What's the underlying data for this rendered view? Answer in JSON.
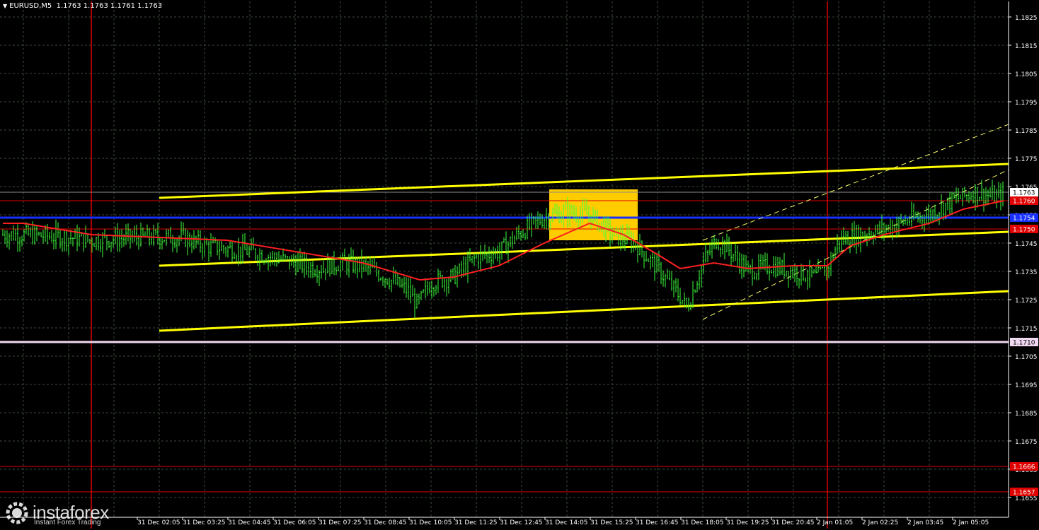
{
  "header": {
    "symbol": "EURUSD,M5",
    "ohlc": "1.1763 1.1763 1.1761 1.1763"
  },
  "watermark": {
    "name": "instaforex",
    "tagline": "Instant Forex Trading"
  },
  "colors": {
    "background": "#000000",
    "grid": "#3a4a3a",
    "candles": "#3cff3c",
    "moving_average": "#ff2020",
    "channel": "#ffff00",
    "trend_dashed": "#ffff66",
    "level_red": "#e00000",
    "level_blue": "#1830ff",
    "level_pink": "#f0d8f0",
    "highlight_box": "#ffcc00",
    "axis_text": "#ffffff"
  },
  "chart_data": {
    "type": "candlestick",
    "title": "EURUSD,M5",
    "ylim": [
      1.165,
      1.183
    ],
    "y_ticks": [
      "1.1825",
      "1.1815",
      "1.1805",
      "1.1795",
      "1.1785",
      "1.1775",
      "1.1765",
      "1.1755",
      "1.1745",
      "1.1735",
      "1.1725",
      "1.1715",
      "1.1705",
      "1.1695",
      "1.1685",
      "1.1675",
      "1.1665",
      "1.1655"
    ],
    "x_ticks": [
      "31 Dec 02:05",
      "31 Dec 03:25",
      "31 Dec 04:45",
      "31 Dec 06:05",
      "31 Dec 07:25",
      "31 Dec 08:45",
      "31 Dec 10:05",
      "31 Dec 11:25",
      "31 Dec 12:45",
      "31 Dec 14:05",
      "31 Dec 15:25",
      "31 Dec 16:45",
      "31 Dec 18:05",
      "31 Dec 19:25",
      "31 Dec 20:45",
      "2 Jan 01:05",
      "2 Jan 02:25",
      "2 Jan 03:45",
      "2 Jan 05:05"
    ],
    "grid": true,
    "price_path": [
      [
        0,
        1.1748
      ],
      [
        2,
        1.1747
      ],
      [
        3,
        1.1746
      ],
      [
        5,
        1.1747
      ],
      [
        7,
        1.1747
      ],
      [
        8,
        1.1744
      ],
      [
        9,
        1.1743
      ],
      [
        10,
        1.1742
      ],
      [
        11,
        1.174
      ],
      [
        12,
        1.1738
      ],
      [
        13,
        1.1736
      ],
      [
        14,
        1.1738
      ],
      [
        15,
        1.1737
      ],
      [
        16,
        1.1733
      ],
      [
        17,
        1.1728
      ],
      [
        17.4,
        1.1723
      ],
      [
        18,
        1.1731
      ],
      [
        19,
        1.1733
      ],
      [
        20,
        1.174
      ],
      [
        21,
        1.1742
      ],
      [
        22,
        1.1749
      ],
      [
        23,
        1.1754
      ],
      [
        24,
        1.1756
      ],
      [
        25,
        1.1755
      ],
      [
        26,
        1.1748
      ],
      [
        27,
        1.1745
      ],
      [
        28,
        1.1736
      ],
      [
        29,
        1.1726
      ],
      [
        29.3,
        1.1722
      ],
      [
        30,
        1.1738
      ],
      [
        30.6,
        1.1746
      ],
      [
        31,
        1.1744
      ],
      [
        32,
        1.1735
      ],
      [
        33,
        1.1737
      ],
      [
        34,
        1.1735
      ],
      [
        35,
        1.1733
      ],
      [
        35.5,
        1.1736
      ],
      [
        36,
        1.1746
      ],
      [
        37,
        1.1748
      ],
      [
        38,
        1.175
      ],
      [
        39,
        1.1753
      ],
      [
        40,
        1.1755
      ],
      [
        41,
        1.176
      ],
      [
        42,
        1.1763
      ],
      [
        43,
        1.1761
      ],
      [
        43.3,
        1.1763
      ]
    ],
    "moving_average": [
      [
        0,
        1.1752
      ],
      [
        3,
        1.1748
      ],
      [
        6,
        1.1747
      ],
      [
        9,
        1.1746
      ],
      [
        12,
        1.1742
      ],
      [
        15,
        1.1738
      ],
      [
        17.5,
        1.1732
      ],
      [
        19,
        1.1733
      ],
      [
        21,
        1.1737
      ],
      [
        23,
        1.1745
      ],
      [
        25,
        1.1752
      ],
      [
        26.5,
        1.1748
      ],
      [
        28,
        1.1741
      ],
      [
        29,
        1.1736
      ],
      [
        30.5,
        1.1738
      ],
      [
        32,
        1.1736
      ],
      [
        34,
        1.1737
      ],
      [
        35.5,
        1.1737
      ],
      [
        36.5,
        1.1744
      ],
      [
        38,
        1.1748
      ],
      [
        40,
        1.1752
      ],
      [
        41.5,
        1.1757
      ],
      [
        43.3,
        1.176
      ]
    ],
    "channel_lines": [
      {
        "x": [
          6,
          46
        ],
        "y": [
          1.1761,
          1.1773
        ]
      },
      {
        "x": [
          6,
          46
        ],
        "y": [
          1.1737,
          1.1749
        ]
      },
      {
        "x": [
          6,
          46
        ],
        "y": [
          1.1714,
          1.1728
        ]
      }
    ],
    "dashed_trend_lines": [
      {
        "x": [
          30,
          46
        ],
        "y": [
          1.1746,
          1.1787
        ]
      },
      {
        "x": [
          30,
          46
        ],
        "y": [
          1.1718,
          1.1771
        ]
      }
    ],
    "vertical_lines_x": [
      3,
      35.5
    ],
    "highlight_box": {
      "x": [
        24,
        28
      ],
      "y": [
        1.1746,
        1.1764
      ]
    },
    "levels": [
      {
        "value": 1.176,
        "label": "1.1760",
        "color": "red"
      },
      {
        "value": 1.1754,
        "label": "1.1754",
        "color": "blue"
      },
      {
        "value": 1.175,
        "label": "1.1750",
        "color": "red"
      },
      {
        "value": 1.171,
        "label": "1.1710",
        "color": "pink"
      },
      {
        "value": 1.1666,
        "label": "1.1666",
        "color": "red"
      },
      {
        "value": 1.1657,
        "label": "1.1657",
        "color": "red"
      }
    ],
    "current_price": {
      "value": 1.1763,
      "label": "1.1763"
    }
  }
}
